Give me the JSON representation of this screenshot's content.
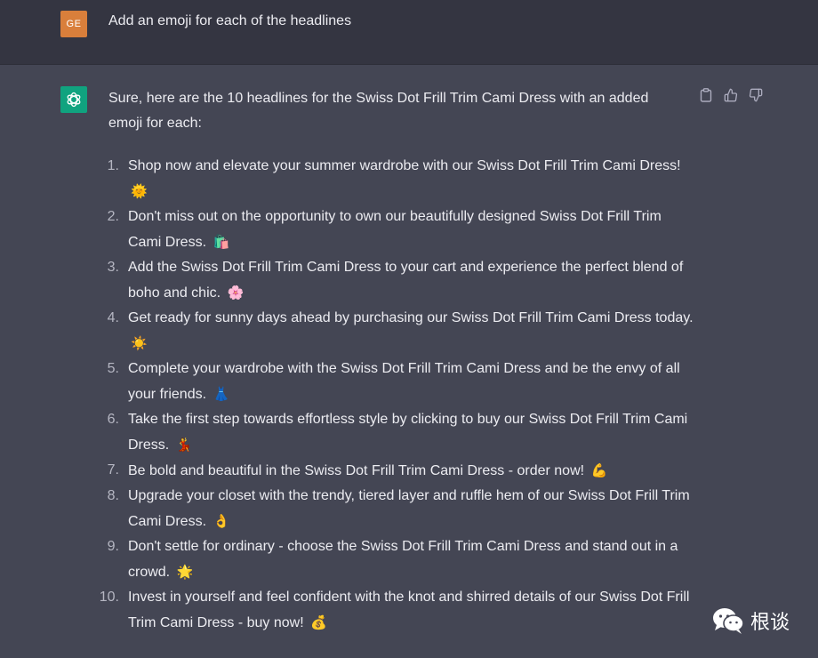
{
  "user_message": {
    "avatar_initials": "GE",
    "text": "Add an emoji for each of the headlines"
  },
  "assistant_message": {
    "intro": "Sure, here are the 10 headlines for the Swiss Dot Frill Trim Cami Dress with an added emoji for each:",
    "items": [
      {
        "num": "1.",
        "text": "Shop now and elevate your summer wardrobe with our Swiss Dot Frill Trim Cami Dress!",
        "emoji": "🌞"
      },
      {
        "num": "2.",
        "text": "Don't miss out on the opportunity to own our beautifully designed Swiss Dot Frill Trim Cami Dress.",
        "emoji": "🛍️"
      },
      {
        "num": "3.",
        "text": "Add the Swiss Dot Frill Trim Cami Dress to your cart and experience the perfect blend of boho and chic.",
        "emoji": "🌸"
      },
      {
        "num": "4.",
        "text": "Get ready for sunny days ahead by purchasing our Swiss Dot Frill Trim Cami Dress today.",
        "emoji": "☀️"
      },
      {
        "num": "5.",
        "text": "Complete your wardrobe with the Swiss Dot Frill Trim Cami Dress and be the envy of all your friends.",
        "emoji": "👗"
      },
      {
        "num": "6.",
        "text": "Take the first step towards effortless style by clicking to buy our Swiss Dot Frill Trim Cami Dress.",
        "emoji": "💃"
      },
      {
        "num": "7.",
        "text": "Be bold and beautiful in the Swiss Dot Frill Trim Cami Dress - order now!",
        "emoji": "💪"
      },
      {
        "num": "8.",
        "text": "Upgrade your closet with the trendy, tiered layer and ruffle hem of our Swiss Dot Frill Trim Cami Dress.",
        "emoji": "👌"
      },
      {
        "num": "9.",
        "text": "Don't settle for ordinary - choose the Swiss Dot Frill Trim Cami Dress and stand out in a crowd.",
        "emoji": "🌟"
      },
      {
        "num": "10.",
        "text": "Invest in yourself and feel confident with the knot and shirred details of our Swiss Dot Frill Trim Cami Dress - buy now!",
        "emoji": "💰"
      }
    ]
  },
  "actions": {
    "icons": [
      "clipboard-icon",
      "thumbs-up-icon",
      "thumbs-down-icon"
    ]
  },
  "watermark": {
    "text": "根谈",
    "icon": "wechat-icon"
  },
  "colors": {
    "user_bg": "#343541",
    "assistant_bg": "#444654",
    "user_avatar": "#d97f3b",
    "bot_avatar": "#10a37f"
  }
}
